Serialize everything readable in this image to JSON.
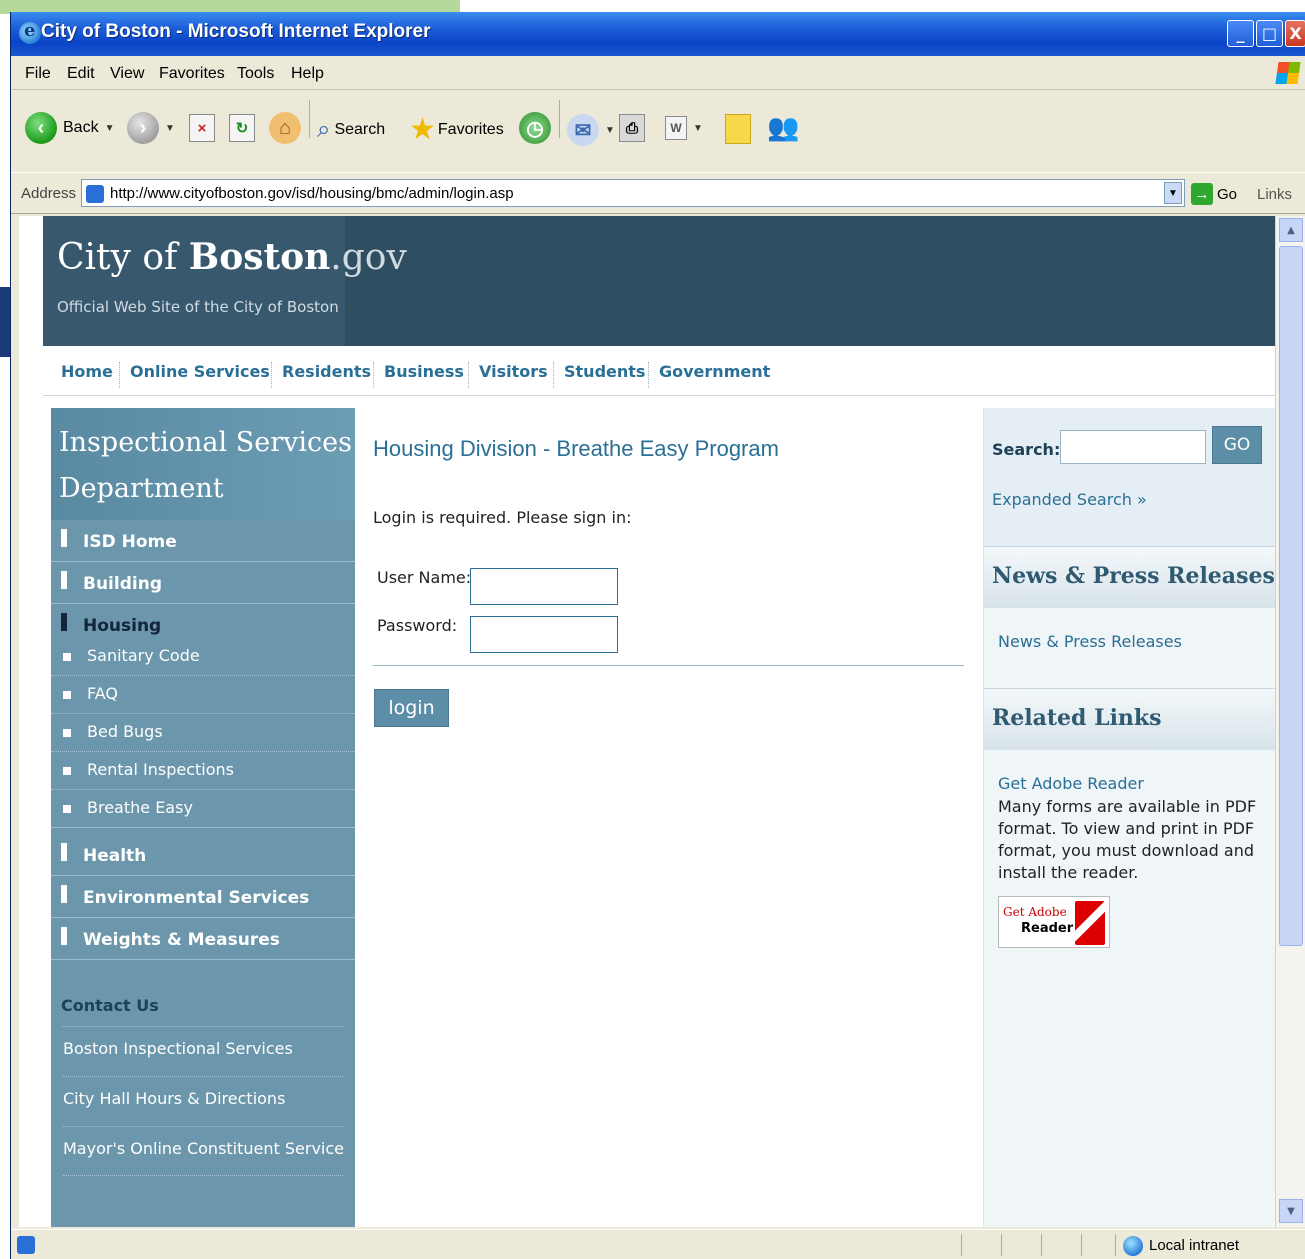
{
  "window": {
    "title": "City of Boston - Microsoft Internet Explorer",
    "controls": [
      "_",
      "□",
      "X"
    ]
  },
  "menu": [
    "File",
    "Edit",
    "View",
    "Favorites",
    "Tools",
    "Help"
  ],
  "toolbar": {
    "back_label": "Back",
    "search_label": "Search",
    "favorites_label": "Favorites"
  },
  "address": {
    "label": "Address",
    "url": "http://www.cityofboston.gov/isd/housing/bmc/admin/login.asp",
    "go_label": "Go",
    "links_label": "Links"
  },
  "site": {
    "logo_city": "City",
    "logo_of": " of ",
    "logo_boston": "Boston",
    "logo_gov": ".gov",
    "tagline": "Official Web Site of the City of Boston"
  },
  "nav": [
    "Home",
    "Online Services",
    "Residents",
    "Business",
    "Visitors",
    "Students",
    "Government"
  ],
  "sidebar": {
    "title_line1": "Inspectional Services",
    "title_line2": "Department",
    "items": [
      {
        "label": "ISD Home"
      },
      {
        "label": "Building"
      },
      {
        "label": "Housing"
      }
    ],
    "subitems": [
      "Sanitary Code",
      "FAQ",
      "Bed Bugs",
      "Rental Inspections",
      "Breathe Easy"
    ],
    "items_after": [
      {
        "label": "Health"
      },
      {
        "label": "Environmental Services"
      },
      {
        "label": "Weights & Measures"
      }
    ],
    "contact_heading": "Contact Us",
    "contact_links": [
      "Boston Inspectional Services",
      "City Hall Hours & Directions",
      "Mayor's Online Constituent Service"
    ]
  },
  "main": {
    "title": "Housing Division - Breathe Easy Program",
    "intro": "Login is required. Please sign in:",
    "username_label": "User Name:",
    "password_label": "Password:",
    "login_button": "login"
  },
  "right": {
    "search_label": "Search:",
    "go_button": "GO",
    "expanded_search": "Expanded Search »",
    "news_heading": "News & Press Releases »",
    "news_link": "News & Press Releases",
    "related_heading": "Related Links",
    "adobe_link": "Get Adobe Reader",
    "adobe_text": "Many forms are available in PDF format. To view and print in PDF format, you must download and install the reader.",
    "adobe_badge_get": "Get Adobe",
    "adobe_badge_reader": "Reader"
  },
  "status": {
    "zone": "Local intranet"
  }
}
